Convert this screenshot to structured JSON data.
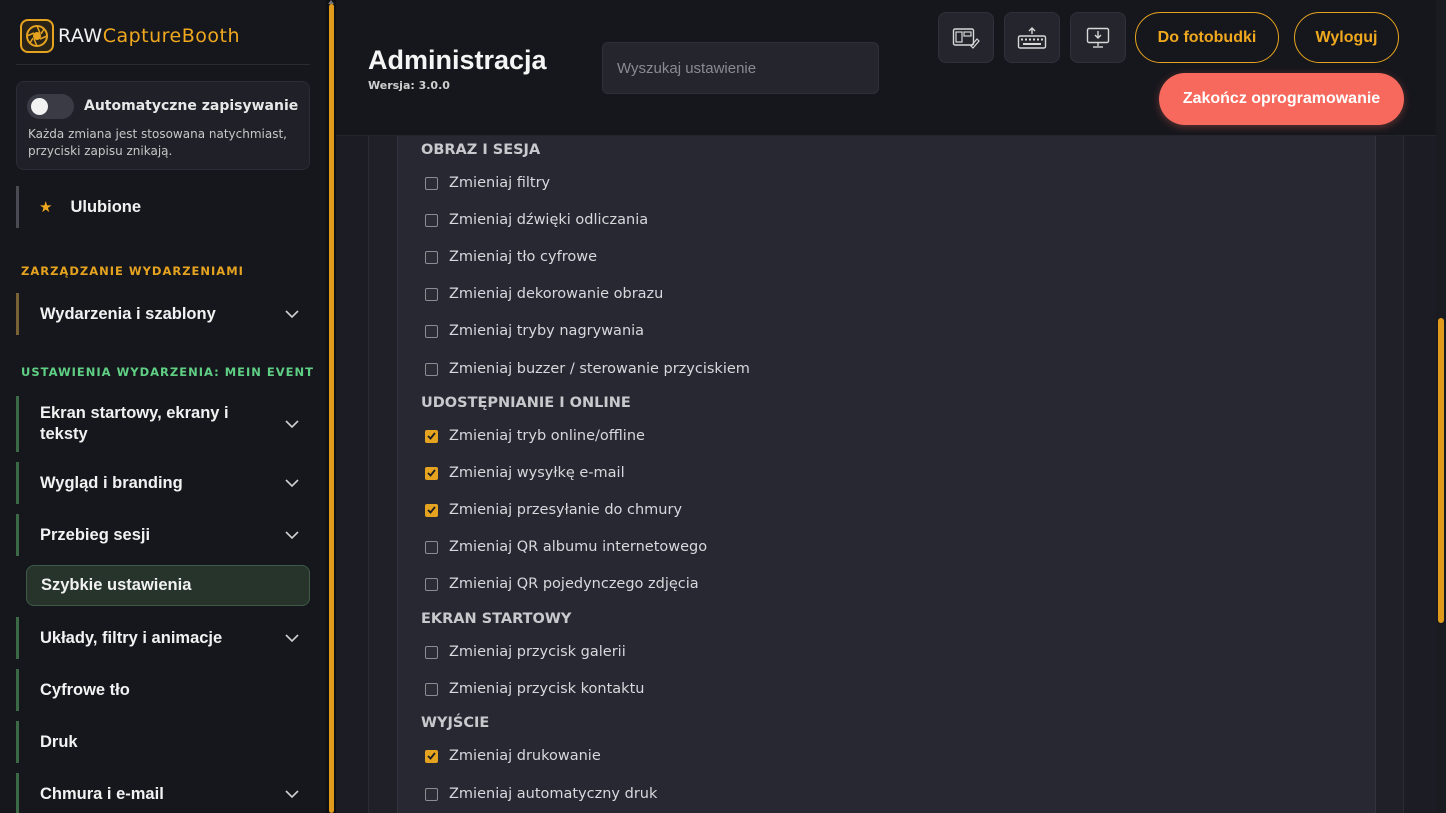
{
  "app": {
    "logo_raw": "RAW",
    "logo_rest": "CaptureBooth"
  },
  "autosave": {
    "title": "Automatyczne zapisywanie",
    "description": "Każda zmiana jest stosowana natychmiast, przyciski zapisu znikają.",
    "enabled": false
  },
  "sidebar": {
    "favorites": "Ulubione",
    "section_events": "ZARZĄDZANIE WYDARZENIAMI",
    "events_item": "Wydarzenia i szablony",
    "section_settings": "USTAWIENIA WYDARZENIA: MEIN EVENT",
    "items": [
      {
        "label": "Ekran startowy, ekrany i teksty",
        "expandable": true
      },
      {
        "label": "Wygląd i branding",
        "expandable": true
      },
      {
        "label": "Przebieg sesji",
        "expandable": true
      },
      {
        "label": "Szybkie ustawienia",
        "expandable": false,
        "active": true
      },
      {
        "label": "Układy, filtry i animacje",
        "expandable": true
      },
      {
        "label": "Cyfrowe tło",
        "expandable": false
      },
      {
        "label": "Druk",
        "expandable": false
      },
      {
        "label": "Chmura i e-mail",
        "expandable": true
      }
    ]
  },
  "header": {
    "title": "Administracja",
    "version": "Wersja: 3.0.0",
    "search_placeholder": "Wyszukaj ustawienie",
    "icon_buttons": [
      "layout-edit-icon",
      "keyboard-upload-icon",
      "monitor-download-icon"
    ],
    "to_booth": "Do fotobudki",
    "logout": "Wyloguj",
    "quit": "Zakończ oprogramowanie"
  },
  "groups": [
    {
      "title": "OBRAZ I SESJA",
      "options": [
        {
          "label": "Zmieniaj filtry",
          "checked": false
        },
        {
          "label": "Zmieniaj dźwięki odliczania",
          "checked": false
        },
        {
          "label": "Zmieniaj tło cyfrowe",
          "checked": false
        },
        {
          "label": "Zmieniaj dekorowanie obrazu",
          "checked": false
        },
        {
          "label": "Zmieniaj tryby nagrywania",
          "checked": false
        },
        {
          "label": "Zmieniaj buzzer / sterowanie przyciskiem",
          "checked": false
        }
      ]
    },
    {
      "title": "UDOSTĘPNIANIE I ONLINE",
      "options": [
        {
          "label": "Zmieniaj tryb online/offline",
          "checked": true
        },
        {
          "label": "Zmieniaj wysyłkę e-mail",
          "checked": true
        },
        {
          "label": "Zmieniaj przesyłanie do chmury",
          "checked": true
        },
        {
          "label": "Zmieniaj QR albumu internetowego",
          "checked": false
        },
        {
          "label": "Zmieniaj QR pojedynczego zdjęcia",
          "checked": false
        }
      ]
    },
    {
      "title": "EKRAN STARTOWY",
      "options": [
        {
          "label": "Zmieniaj przycisk galerii",
          "checked": false
        },
        {
          "label": "Zmieniaj przycisk kontaktu",
          "checked": false
        }
      ]
    },
    {
      "title": "WYJŚCIE",
      "options": [
        {
          "label": "Zmieniaj drukowanie",
          "checked": true
        },
        {
          "label": "Zmieniaj automatyczny druk",
          "checked": false
        }
      ]
    }
  ],
  "colors": {
    "accent": "#e6a31f",
    "danger": "#f7695c",
    "section_green": "#5fcf84"
  }
}
